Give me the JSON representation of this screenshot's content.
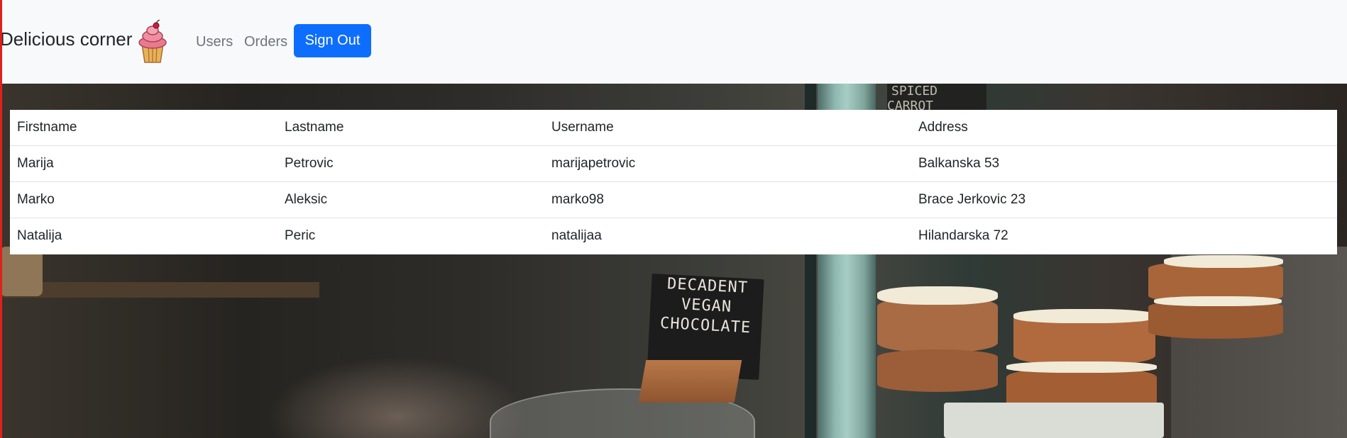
{
  "header": {
    "brand": "Delicious corner",
    "logo_icon": "cupcake-icon",
    "nav": [
      {
        "label": "Users"
      },
      {
        "label": "Orders"
      }
    ],
    "sign_out_label": "Sign Out",
    "accent_color": "#0d6efd"
  },
  "background": {
    "chalkboard_lines": [
      "DECADENT",
      "VEGAN",
      "CHOCOLATE"
    ],
    "top_sign": "SPICED CARROT"
  },
  "table": {
    "columns": [
      "Firstname",
      "Lastname",
      "Username",
      "Address"
    ],
    "rows": [
      [
        "Marija",
        "Petrovic",
        "marijapetrovic",
        "Balkanska 53"
      ],
      [
        "Marko",
        "Aleksic",
        "marko98",
        "Brace Jerkovic 23"
      ],
      [
        "Natalija",
        "Peric",
        "natalijaa",
        "Hilandarska 72"
      ]
    ]
  }
}
